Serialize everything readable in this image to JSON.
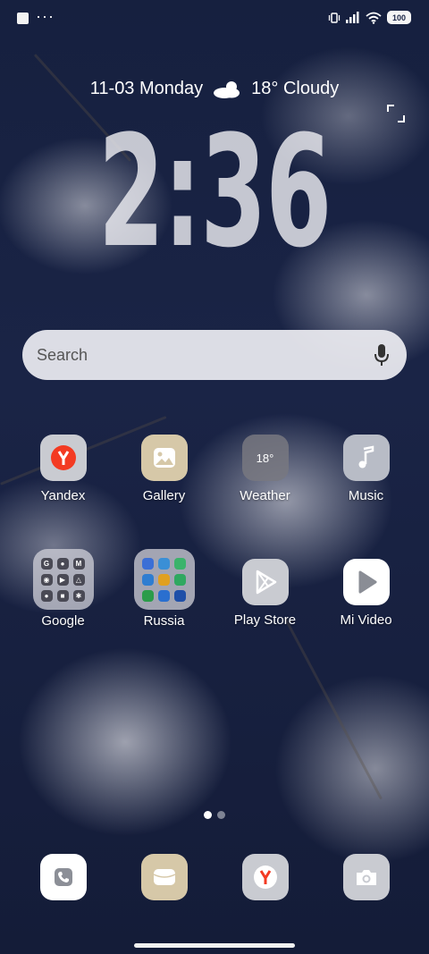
{
  "status_bar": {
    "dots": "···",
    "battery": "100"
  },
  "lock": {
    "date": "11-03 Monday",
    "weather": "18° Cloudy",
    "time": "2:36"
  },
  "search": {
    "placeholder": "Search"
  },
  "apps_row1": [
    {
      "label": "Yandex",
      "icon": "yandex-icon"
    },
    {
      "label": "Gallery",
      "icon": "gallery-icon"
    },
    {
      "label": "Weather",
      "icon": "weather-app-icon",
      "badge": "18°"
    },
    {
      "label": "Music",
      "icon": "music-note-icon"
    }
  ],
  "apps_row2": [
    {
      "label": "Google",
      "icon": "google-folder-icon"
    },
    {
      "label": "Russia",
      "icon": "russia-folder-icon"
    },
    {
      "label": "Play Store",
      "icon": "play-store-icon"
    },
    {
      "label": "Mi Video",
      "icon": "mi-video-icon"
    }
  ],
  "google_folder_letters": [
    "G",
    "",
    "M",
    "",
    "",
    "",
    "",
    "",
    ""
  ],
  "pager": {
    "pages": 2,
    "current": 1
  },
  "dock": [
    {
      "name": "phone",
      "icon": "phone-icon"
    },
    {
      "name": "messages",
      "icon": "message-icon"
    },
    {
      "name": "yandex-browser",
      "icon": "yandex-icon"
    },
    {
      "name": "camera",
      "icon": "camera-icon"
    }
  ],
  "colors": {
    "yandex_red": "#f33a22",
    "tile_light": "#c9cbd1",
    "gallery_beige": "#d6c8a8",
    "background": "#16203f"
  }
}
